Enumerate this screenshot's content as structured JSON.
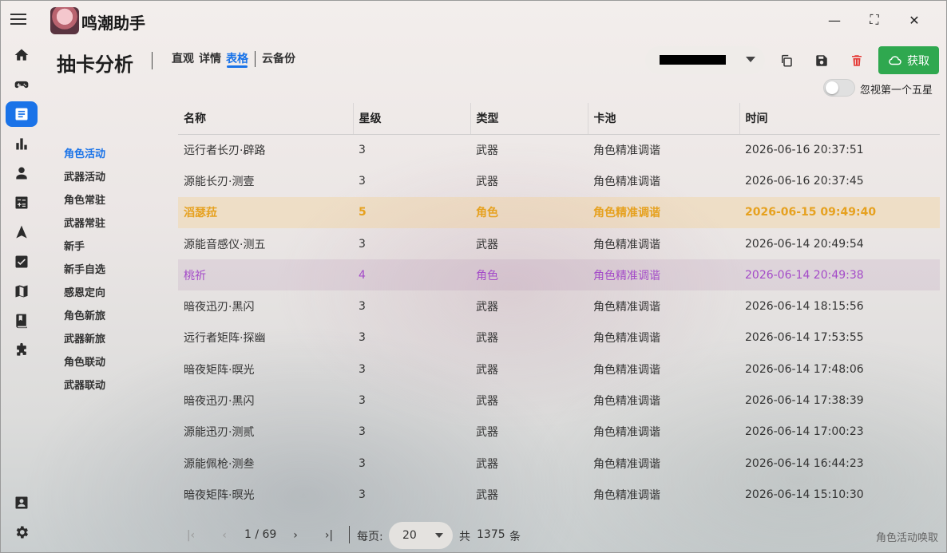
{
  "app": {
    "title": "鸣潮助手"
  },
  "window_controls": {
    "minimize": "—",
    "maximize": "⛶",
    "close": "✕"
  },
  "nav_rail": [
    {
      "icon": "home-icon"
    },
    {
      "icon": "gamepad-icon"
    },
    {
      "icon": "document-icon",
      "active": true
    },
    {
      "icon": "bar-chart-icon"
    },
    {
      "icon": "person-icon"
    },
    {
      "icon": "calculator-icon"
    },
    {
      "icon": "navigation-icon"
    },
    {
      "icon": "checkbox-icon"
    },
    {
      "icon": "map-icon"
    },
    {
      "icon": "book-icon"
    },
    {
      "icon": "puzzle-icon"
    },
    {
      "icon": "contact-card-icon"
    },
    {
      "icon": "settings-icon"
    }
  ],
  "header": {
    "title": "抽卡分析",
    "tabs": [
      "直观",
      "详情",
      "表格",
      "云备份"
    ],
    "active_tab": "表格",
    "fetch_label": "获取",
    "toggle_label": "忽视第一个五星",
    "toggle_on": false
  },
  "pools": [
    "角色活动",
    "武器活动",
    "角色常驻",
    "武器常驻",
    "新手",
    "新手自选",
    "感恩定向",
    "角色新旅",
    "武器新旅",
    "角色联动",
    "武器联动"
  ],
  "active_pool": "角色活动",
  "table": {
    "columns": [
      "名称",
      "星级",
      "类型",
      "卡池",
      "时间"
    ],
    "rows": [
      {
        "name": "远行者长刃·辟路",
        "star": "3",
        "type": "武器",
        "pool": "角色精准调谐",
        "time": "2026-06-16 20:37:51",
        "tone": ""
      },
      {
        "name": "源能长刃·测壹",
        "star": "3",
        "type": "武器",
        "pool": "角色精准调谐",
        "time": "2026-06-16 20:37:45",
        "tone": ""
      },
      {
        "name": "滔瑟菈",
        "star": "5",
        "type": "角色",
        "pool": "角色精准调谐",
        "time": "2026-06-15 09:49:40",
        "tone": "gold"
      },
      {
        "name": "源能音感仪·测五",
        "star": "3",
        "type": "武器",
        "pool": "角色精准调谐",
        "time": "2026-06-14 20:49:54",
        "tone": ""
      },
      {
        "name": "桃祈",
        "star": "4",
        "type": "角色",
        "pool": "角色精准调谐",
        "time": "2026-06-14 20:49:38",
        "tone": "purple"
      },
      {
        "name": "暗夜迅刃·黑闪",
        "star": "3",
        "type": "武器",
        "pool": "角色精准调谐",
        "time": "2026-06-14 18:15:56",
        "tone": ""
      },
      {
        "name": "远行者矩阵·探幽",
        "star": "3",
        "type": "武器",
        "pool": "角色精准调谐",
        "time": "2026-06-14 17:53:55",
        "tone": ""
      },
      {
        "name": "暗夜矩阵·暝光",
        "star": "3",
        "type": "武器",
        "pool": "角色精准调谐",
        "time": "2026-06-14 17:48:06",
        "tone": ""
      },
      {
        "name": "暗夜迅刃·黑闪",
        "star": "3",
        "type": "武器",
        "pool": "角色精准调谐",
        "time": "2026-06-14 17:38:39",
        "tone": ""
      },
      {
        "name": "源能迅刃·测贰",
        "star": "3",
        "type": "武器",
        "pool": "角色精准调谐",
        "time": "2026-06-14 17:00:23",
        "tone": ""
      },
      {
        "name": "源能佩枪·测叁",
        "star": "3",
        "type": "武器",
        "pool": "角色精准调谐",
        "time": "2026-06-14 16:44:23",
        "tone": ""
      },
      {
        "name": "暗夜矩阵·暝光",
        "star": "3",
        "type": "武器",
        "pool": "角色精准调谐",
        "time": "2026-06-14 15:10:30",
        "tone": ""
      }
    ]
  },
  "pagination": {
    "page_display": "1 / 69",
    "per_page_label": "每页:",
    "per_page_value": "20",
    "total_prefix": "共",
    "total": "1375",
    "total_suffix": "条"
  },
  "status_hint": "角色活动唤取",
  "colors": {
    "accent": "#1a73e8",
    "fetch_green": "#2fa84f",
    "five_star": "#e6a11f",
    "four_star": "#a44bc8",
    "delete_red": "#e53935"
  }
}
